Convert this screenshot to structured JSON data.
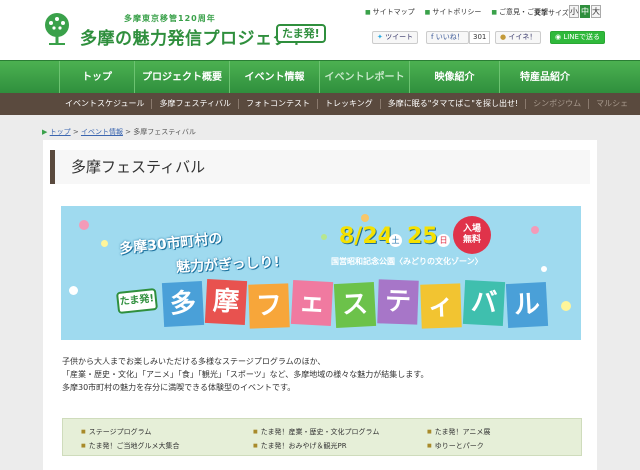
{
  "header": {
    "logo_subtitle": "多摩東京移管120周年",
    "logo_title": "多摩の魅力発信プロジェクト",
    "logo_badge": "たま発!",
    "util_links": [
      "サイトマップ",
      "サイトポリシー",
      "ご意見・ご要望"
    ],
    "text_size_label": "文字サイズ",
    "text_sizes": [
      "小",
      "中",
      "大"
    ],
    "share": {
      "tweet": "ツイート",
      "like": "いいね！",
      "like_count": "301",
      "iine": "イイネ！",
      "line": "LINEで送る"
    }
  },
  "nav": {
    "items": [
      "トップ",
      "プロジェクト概要",
      "イベント情報",
      "イベントレポート",
      "映像紹介",
      "特産品紹介"
    ]
  },
  "subnav": {
    "items": [
      "イベントスケジュール",
      "多摩フェスティバル",
      "フォトコンテスト",
      "トレッキング",
      "多摩に眠る\"タマてばこ\"を探し出せ!",
      "シンポジウム",
      "マルシェ"
    ]
  },
  "breadcrumb": {
    "top": "トップ",
    "events": "イベント情報",
    "current": "多摩フェスティバル"
  },
  "page": {
    "title": "多摩フェスティバル"
  },
  "banner": {
    "catch_line1": "多摩30市町村の",
    "catch_line2": "魅力がぎっしり!",
    "date_day1": "8/24",
    "date_dow1": "土",
    "date_day2": "25",
    "date_dow2": "日",
    "free_line1": "入場",
    "free_line2": "無料",
    "venue": "国営昭和記念公園〈みどりの文化ゾーン〉",
    "badge": "たま発!",
    "festival_chars": [
      "多",
      "摩",
      "フ",
      "ェ",
      "ス",
      "テ",
      "ィ",
      "バ",
      "ル"
    ]
  },
  "intro": {
    "lines": [
      "子供から大人までお楽しみいただける多様なステージプログラムのほか、",
      "「産業・歴史・文化」「アニメ」「食」「観光」「スポーツ」など、多摩地域の様々な魅力が結集します。",
      "多摩30市町村の魅力を存分に満喫できる体験型のイベントです。"
    ]
  },
  "program_links": [
    "ステージプログラム",
    "たま発！産業・歴史・文化プログラム",
    "たま発！アニメ展",
    "たま発！ご当地グルメ大集合",
    "たま発！おみやげ＆観光PR",
    "ゆりーとパーク"
  ],
  "colors": {
    "brand_green": "#2f8f3d",
    "subnav_brown": "#5a4a3e",
    "banner_sky": "#9fdaef",
    "date_yellow": "#f5e100",
    "free_red": "#e0334a"
  }
}
